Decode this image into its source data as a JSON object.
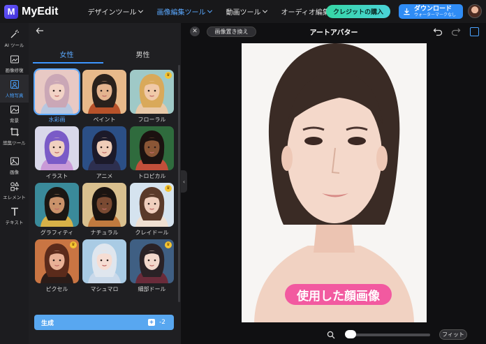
{
  "app": {
    "name": "MyEdit",
    "logo_letter": "M"
  },
  "topnav": [
    {
      "label": "デザインツール",
      "active": false
    },
    {
      "label": "画像編集ツール",
      "active": true
    },
    {
      "label": "動画ツール",
      "active": false
    },
    {
      "label": "オーディオ編集ツール",
      "active": false
    }
  ],
  "header": {
    "credit_button": "クレジットの購入",
    "download_title": "ダウンロード",
    "download_sub": "ウォーターマークなし"
  },
  "rail": [
    {
      "label": "AI ツール",
      "icon": "magic-wand-icon"
    },
    {
      "label": "画像修復",
      "icon": "image-repair-icon"
    },
    {
      "label": "人物写真",
      "icon": "portrait-icon",
      "active": true
    },
    {
      "label": "背景",
      "icon": "background-icon"
    },
    {
      "label": "編集ツール",
      "icon": "crop-icon"
    },
    {
      "label": "画像",
      "icon": "image-icon"
    },
    {
      "label": "エレメント",
      "icon": "elements-icon"
    },
    {
      "label": "テキスト",
      "icon": "text-icon"
    }
  ],
  "panel": {
    "tabs": [
      {
        "label": "女性",
        "active": true
      },
      {
        "label": "男性",
        "active": false
      }
    ],
    "styles": [
      {
        "label": "水彩画",
        "selected": true,
        "premium": false,
        "bg": "#e8c9c4",
        "hair": "#caa7b6",
        "skin": "#f2d3c6",
        "cloth": "#b7c7e0"
      },
      {
        "label": "ペイント",
        "selected": false,
        "premium": false,
        "bg": "#e8b98a",
        "hair": "#2a211c",
        "skin": "#e4b48f",
        "cloth": "#b8522a"
      },
      {
        "label": "フローラル",
        "selected": false,
        "premium": true,
        "bg": "#9fc9c7",
        "hair": "#d9a95a",
        "skin": "#f0c9a8",
        "cloth": "#e9c9a8"
      },
      {
        "label": "イラスト",
        "selected": false,
        "premium": false,
        "bg": "#d9d8ea",
        "hair": "#7a5bc7",
        "skin": "#f0d0c0",
        "cloth": "#c99ad7"
      },
      {
        "label": "アニメ",
        "selected": false,
        "premium": false,
        "bg": "#2b4f86",
        "hair": "#1c1a2a",
        "skin": "#efcdb8",
        "cloth": "#2d2f4f"
      },
      {
        "label": "トロピカル",
        "selected": false,
        "premium": false,
        "bg": "#2f6b3d",
        "hair": "#1b1210",
        "skin": "#8a5636",
        "cloth": "#c24f3a"
      },
      {
        "label": "グラフィティ",
        "selected": false,
        "premium": false,
        "bg": "#3a8a9a",
        "hair": "#1b1713",
        "skin": "#c9926a",
        "cloth": "#d8b248"
      },
      {
        "label": "ナチュラル",
        "selected": false,
        "premium": false,
        "bg": "#d9c08f",
        "hair": "#1a1411",
        "skin": "#7a4a32",
        "cloth": "#c07a3f"
      },
      {
        "label": "クレイドール",
        "selected": false,
        "premium": true,
        "bg": "#d5e3ef",
        "hair": "#5a3a2a",
        "skin": "#f0cfbe",
        "cloth": "#efe0d2"
      },
      {
        "label": "ピクセル",
        "selected": false,
        "premium": true,
        "bg": "#c97543",
        "hair": "#5b2b1b",
        "skin": "#e8b196",
        "cloth": "#2b1c18"
      },
      {
        "label": "マシュマロ",
        "selected": false,
        "premium": false,
        "bg": "#a9cbe4",
        "hair": "#dfe6ee",
        "skin": "#f6ddd3",
        "cloth": "#c9d9ea"
      },
      {
        "label": "細部ドール",
        "selected": false,
        "premium": true,
        "bg": "#3f5f83",
        "hair": "#2a2226",
        "skin": "#f2d8cc",
        "cloth": "#6a2b3a"
      }
    ],
    "generate_label": "生成",
    "generate_cost": "-2"
  },
  "workspace": {
    "replace_button": "画像置き換え",
    "title": "アートアバター",
    "photo_label": "使用した顔画像",
    "fit_button": "フィット",
    "zoom": 0
  },
  "colors": {
    "accent": "#3d95ff",
    "credit": "#36d6a4",
    "pill": "#f25aa0"
  }
}
